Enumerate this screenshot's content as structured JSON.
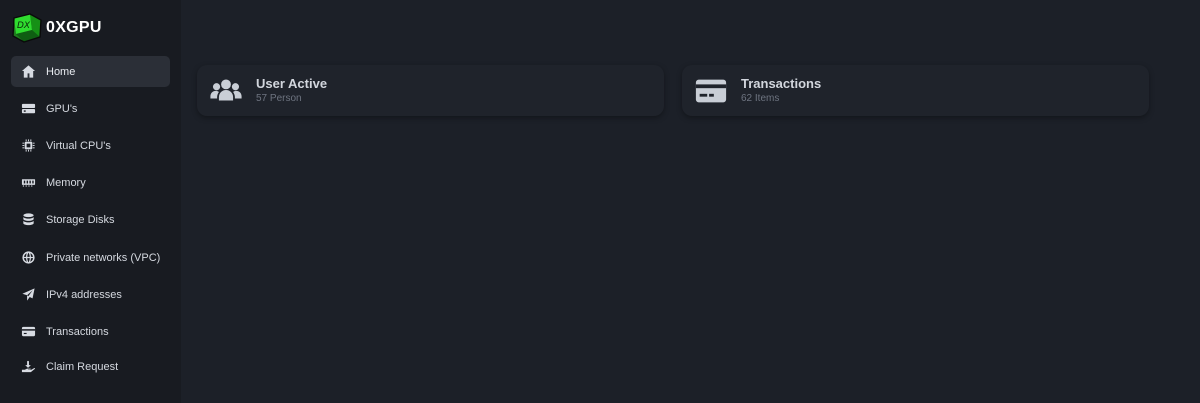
{
  "brand": {
    "name": "0XGPU",
    "logo_text": "DX",
    "logo_color": "#27c93f"
  },
  "sidebar": {
    "items": [
      {
        "label": "Home",
        "icon": "home-icon",
        "active": true
      },
      {
        "label": "GPU's",
        "icon": "server-icon",
        "active": false
      },
      {
        "label": "Virtual CPU's",
        "icon": "chip-icon",
        "active": false
      },
      {
        "label": "Memory",
        "icon": "memory-icon",
        "active": false
      },
      {
        "label": "Storage Disks",
        "icon": "database-icon",
        "active": false
      },
      {
        "label": "Private networks (VPC)",
        "icon": "globe-icon",
        "active": false
      },
      {
        "label": "IPv4 addresses",
        "icon": "send-icon",
        "active": false
      },
      {
        "label": "Transactions",
        "icon": "credit-card-icon",
        "active": false
      },
      {
        "label": "Claim Request",
        "icon": "hand-holding-icon",
        "active": false
      }
    ]
  },
  "cards": [
    {
      "title": "User Active",
      "subtitle": "57 Person",
      "icon": "users-icon"
    },
    {
      "title": "Transactions",
      "subtitle": "62 Items",
      "icon": "credit-card-icon"
    }
  ],
  "colors": {
    "background": "#1c2028",
    "sidebar": "#181b21",
    "card": "#1f232b",
    "active_item": "#2b2f37"
  }
}
